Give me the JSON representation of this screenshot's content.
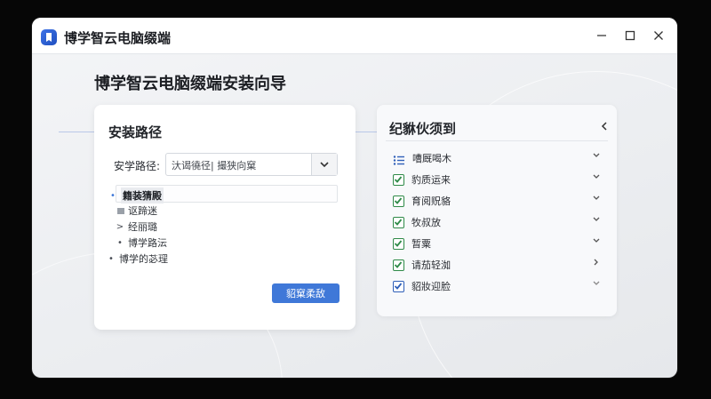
{
  "window": {
    "title": "博学智云电脑缀端"
  },
  "page": {
    "heading": "博学智云电脑缀端安装向导"
  },
  "install_path_card": {
    "title": "安装路径",
    "path_label": "安学路径:",
    "path_value": "汏谒徺径| 撮狭向窠",
    "tree": [
      {
        "label": "籍装猜殿",
        "marker": "•",
        "selected": true
      },
      {
        "label": "讴蹄迷",
        "marker": "square"
      },
      {
        "label": "经丽璐",
        "marker": ">"
      },
      {
        "label": "博学路沄",
        "marker": "•"
      },
      {
        "label": "博学的苾理",
        "marker": "•"
      }
    ],
    "primary_button": "貂窠柔敌"
  },
  "options_card": {
    "title": "纪貅伙须到",
    "items": [
      {
        "label": "嘈厩喝木",
        "icon": "list-icon",
        "chevron": "down"
      },
      {
        "label": "豹质运来",
        "icon": "checked-icon",
        "chevron": "down"
      },
      {
        "label": "育阅贶貉",
        "icon": "checked-icon",
        "chevron": "down"
      },
      {
        "label": "牧叔放",
        "icon": "checked-icon",
        "chevron": "down"
      },
      {
        "label": "暂粟",
        "icon": "checked-icon",
        "chevron": "down"
      },
      {
        "label": "请茄轻洳",
        "icon": "checked-icon",
        "chevron": "right"
      },
      {
        "label": "貂妝迎脸",
        "icon": "checked-icon-blue",
        "chevron": "down"
      }
    ]
  },
  "colors": {
    "accent": "#3f78d8",
    "check": "#2f8a48"
  }
}
